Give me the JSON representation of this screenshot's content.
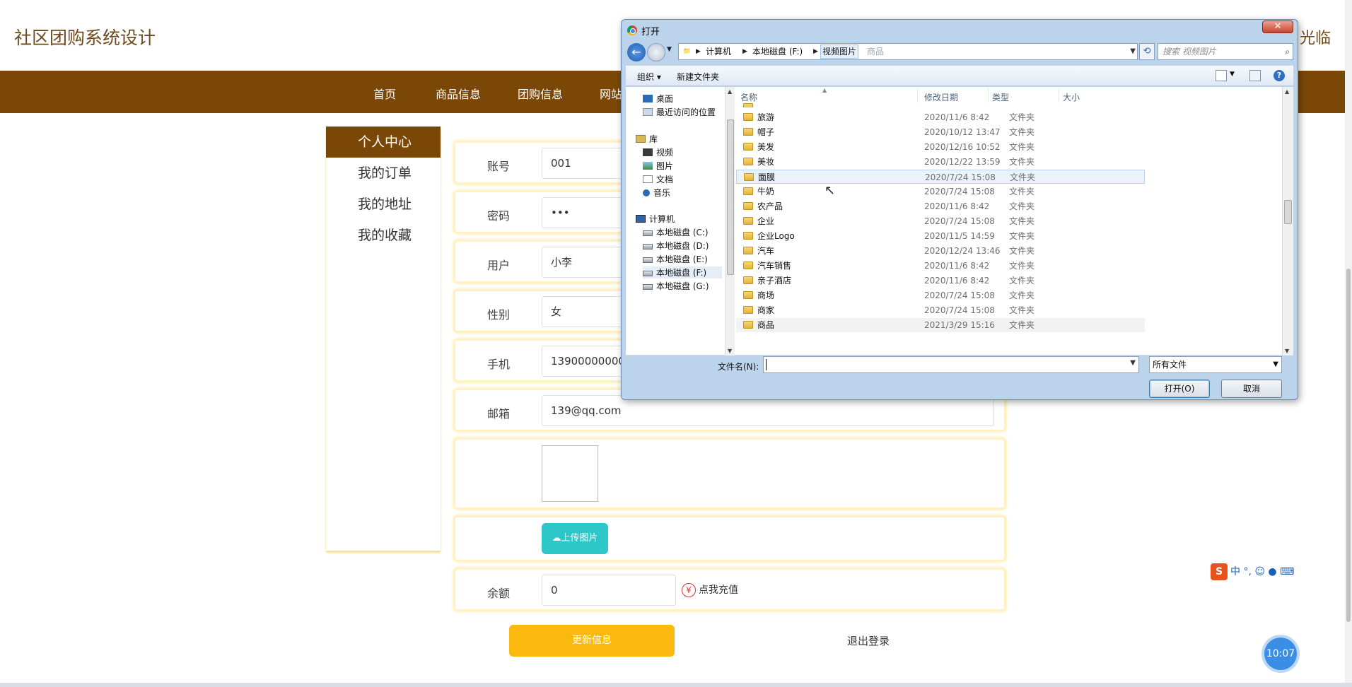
{
  "site": {
    "title": "社区团购系统设计",
    "welcome": "光临"
  },
  "nav": [
    "首页",
    "商品信息",
    "团购信息",
    "网站"
  ],
  "sidebar": [
    "个人中心",
    "我的订单",
    "我的地址",
    "我的收藏"
  ],
  "form": {
    "account": {
      "label": "账号",
      "value": "001"
    },
    "password": {
      "label": "密码",
      "value": "•••"
    },
    "user": {
      "label": "用户",
      "value": "小李"
    },
    "gender": {
      "label": "性别",
      "value": "女"
    },
    "phone": {
      "label": "手机",
      "value": "13900000000"
    },
    "email": {
      "label": "邮箱",
      "value": "139@qq.com"
    },
    "upload_label": "上传图片",
    "balance": {
      "label": "余额",
      "value": "0"
    },
    "recharge_label": "点我充值",
    "update_label": "更新信息",
    "logout_label": "退出登录"
  },
  "ime": {
    "logo": "S",
    "mode": "中"
  },
  "clock": "10:07",
  "dialog": {
    "title": "打开",
    "close": "✕",
    "breadcrumbs": [
      "计算机",
      "本地磁盘 (F:)",
      "视频图片"
    ],
    "address_ghost": "商品",
    "search_placeholder": "搜索 视频图片",
    "toolbar": {
      "organize": "组织 ▾",
      "new_folder": "新建文件夹",
      "help": "?"
    },
    "tree": {
      "desktop": "桌面",
      "recent": "最近访问的位置",
      "library": "库",
      "videos": "视频",
      "pictures": "图片",
      "documents": "文档",
      "music": "音乐",
      "computer": "计算机",
      "drives": [
        "本地磁盘 (C:)",
        "本地磁盘 (D:)",
        "本地磁盘 (E:)",
        "本地磁盘 (F:)",
        "本地磁盘 (G:)"
      ]
    },
    "columns": {
      "name": "名称",
      "date": "修改日期",
      "type": "类型",
      "size": "大小"
    },
    "files": [
      {
        "name": "旅游",
        "date": "2020/11/6 8:42",
        "type": "文件夹"
      },
      {
        "name": "帽子",
        "date": "2020/10/12 13:47",
        "type": "文件夹"
      },
      {
        "name": "美发",
        "date": "2020/12/16 10:52",
        "type": "文件夹"
      },
      {
        "name": "美妆",
        "date": "2020/12/22 13:59",
        "type": "文件夹"
      },
      {
        "name": "面膜",
        "date": "2020/7/24 15:08",
        "type": "文件夹"
      },
      {
        "name": "牛奶",
        "date": "2020/7/24 15:08",
        "type": "文件夹"
      },
      {
        "name": "农产品",
        "date": "2020/11/6 8:42",
        "type": "文件夹"
      },
      {
        "name": "企业",
        "date": "2020/7/24 15:08",
        "type": "文件夹"
      },
      {
        "name": "企业Logo",
        "date": "2020/11/5 14:59",
        "type": "文件夹"
      },
      {
        "name": "汽车",
        "date": "2020/12/24 13:46",
        "type": "文件夹"
      },
      {
        "name": "汽车销售",
        "date": "2020/11/6 8:42",
        "type": "文件夹"
      },
      {
        "name": "亲子酒店",
        "date": "2020/11/6 8:42",
        "type": "文件夹"
      },
      {
        "name": "商场",
        "date": "2020/7/24 15:08",
        "type": "文件夹"
      },
      {
        "name": "商家",
        "date": "2020/7/24 15:08",
        "type": "文件夹"
      },
      {
        "name": "商品",
        "date": "2021/3/29 15:16",
        "type": "文件夹"
      }
    ],
    "filename_label": "文件名(N):",
    "filename_value": "",
    "filetype": "所有文件",
    "open_label": "打开(O)",
    "cancel_label": "取消"
  }
}
